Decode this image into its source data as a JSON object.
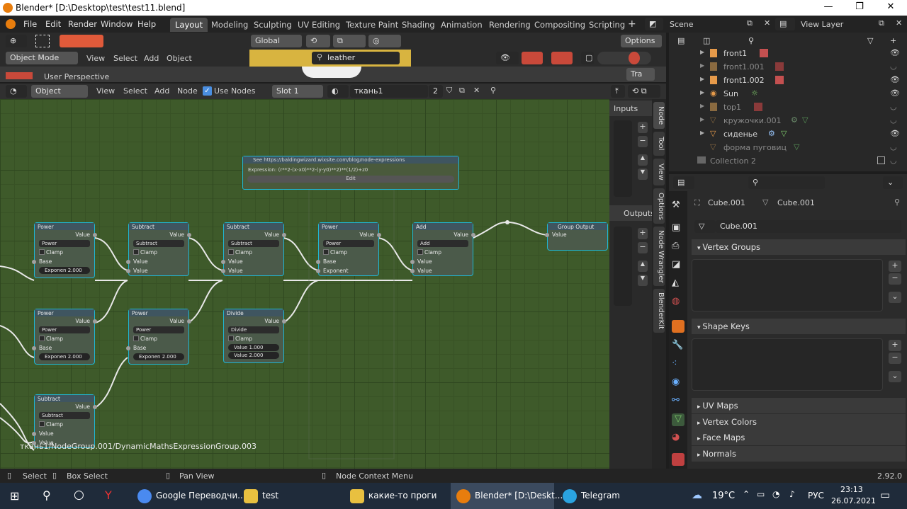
{
  "window": {
    "title": "Blender* [D:\\Desktop\\test\\test11.blend]",
    "min": "—",
    "max": "❐",
    "close": "✕"
  },
  "menu": [
    "File",
    "Edit",
    "Render",
    "Window",
    "Help"
  ],
  "workspaces": [
    "Layout",
    "Modeling",
    "Sculpting",
    "UV Editing",
    "Texture Paint",
    "Shading",
    "Animation",
    "Rendering",
    "Compositing",
    "Scripting"
  ],
  "scene": {
    "label": "Scene",
    "view_layer": "View Layer"
  },
  "viewport": {
    "orientation": "Global",
    "options": "Options",
    "mode": "Object Mode",
    "menus": [
      "View",
      "Select",
      "Add",
      "Object"
    ],
    "material_search": "leather",
    "overlay_label": "User Perspective",
    "tab_label": "Tra"
  },
  "node_editor": {
    "type": "Object",
    "menus": [
      "View",
      "Select",
      "Add",
      "Node"
    ],
    "use_nodes": "Use Nodes",
    "slot": "Slot 1",
    "material": "ткань1",
    "users": "2",
    "path": "ткань1/NodeGroup.001/DynamicMathsExpressionGroup.003"
  },
  "expression_frame": {
    "title": "See https://baldingwizard.wixsite.com/blog/node-expressions",
    "expression": "Expression: (r**2-(x-x0)**2-(y-y0)**2)**(1/2)+z0",
    "button": "Edit"
  },
  "nodes": {
    "power1": {
      "title": "Power",
      "out": "Value",
      "op": "Power",
      "clamp": "Clamp",
      "in1": "Base",
      "field": "Exponen 2.000"
    },
    "power2": {
      "title": "Power",
      "out": "Value",
      "op": "Power",
      "clamp": "Clamp",
      "in1": "Base",
      "field": "Exponen 2.000"
    },
    "subtract1": {
      "title": "Subtract",
      "out": "Value",
      "op": "Subtract",
      "clamp": "Clamp",
      "in1": "Value",
      "in2": "Value"
    },
    "subtract2": {
      "title": "Subtract",
      "out": "Value",
      "op": "Subtract",
      "clamp": "Clamp",
      "in1": "Value",
      "in2": "Value"
    },
    "power3": {
      "title": "Power",
      "out": "Value",
      "op": "Power",
      "clamp": "Clamp",
      "in1": "Base",
      "field": "Exponen 2.000"
    },
    "subtract3": {
      "title": "Subtract",
      "out": "Value",
      "op": "Subtract",
      "clamp": "Clamp",
      "in1": "Value",
      "in2": "Value"
    },
    "divide": {
      "title": "Divide",
      "out": "Value",
      "op": "Divide",
      "clamp": "Clamp",
      "f1": "Value     1.000",
      "f2": "Value     2.000"
    },
    "power4": {
      "title": "Power",
      "out": "Value",
      "op": "Power",
      "clamp": "Clamp",
      "in1": "Base",
      "in2": "Exponent"
    },
    "add": {
      "title": "Add",
      "out": "Value",
      "op": "Add",
      "clamp": "Clamp",
      "in1": "Value",
      "in2": "Value"
    },
    "group_output": {
      "title": "Group Output",
      "in1": "Value"
    }
  },
  "sidebar": {
    "inputs": "Inputs",
    "outputs": "Outputs",
    "tabs": [
      "Node",
      "Tool",
      "View",
      "Options",
      "Node Wrangler",
      "BlenderKit"
    ]
  },
  "outliner": [
    {
      "name": "front1",
      "dim": false
    },
    {
      "name": "front1.001",
      "dim": true
    },
    {
      "name": "front1.002",
      "dim": false
    },
    {
      "name": "Sun",
      "dim": false
    },
    {
      "name": "top1",
      "dim": true
    },
    {
      "name": "кружочки.001",
      "dim": true
    },
    {
      "name": "сиденье",
      "dim": false
    },
    {
      "name": "форма пуговиц",
      "dim": true
    },
    {
      "name": "Collection 2",
      "dim": true
    }
  ],
  "properties": {
    "object": "Cube.001",
    "mesh": "Cube.001",
    "data": "Cube.001",
    "panels": [
      "Vertex Groups",
      "Shape Keys",
      "UV Maps",
      "Vertex Colors",
      "Face Maps",
      "Normals"
    ]
  },
  "status": {
    "select": "Select",
    "box": "Box Select",
    "pan": "Pan View",
    "ctx": "Node Context Menu",
    "version": "2.92.0"
  },
  "taskbar": {
    "apps": [
      "Google Переводчи...",
      "test",
      "какие-то проги",
      "Blender* [D:\\Deskt...",
      "Telegram"
    ],
    "temp": "19°C",
    "lang": "РУС",
    "time": "23:13",
    "date": "26.07.2021"
  },
  "colors": {
    "accent": "#4a4a4a",
    "node_border": "#1fb7d4",
    "grid": "#3e5a2a"
  }
}
